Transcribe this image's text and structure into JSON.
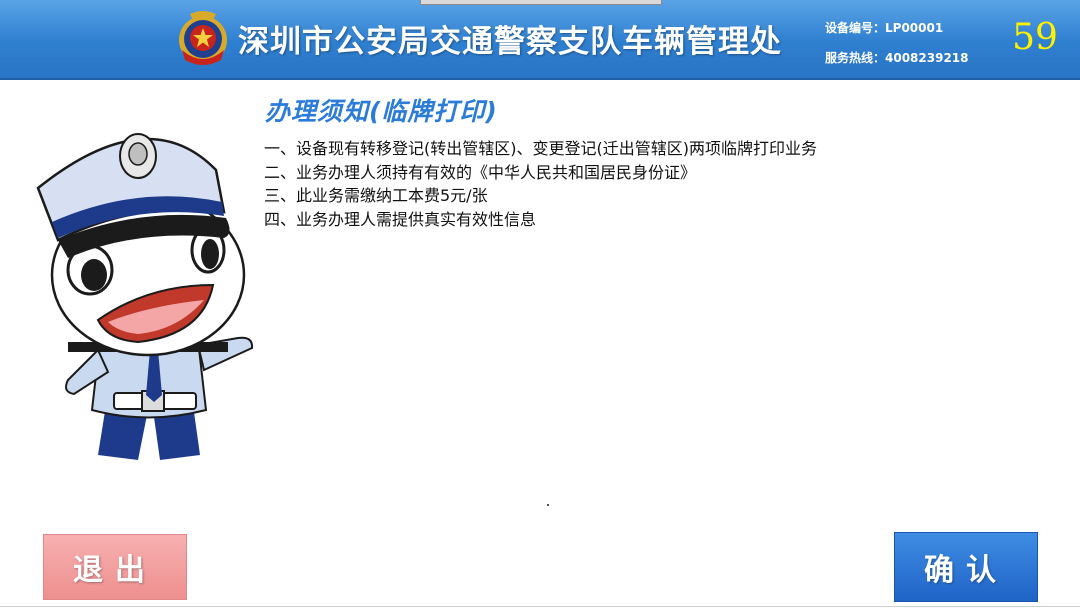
{
  "header": {
    "org_title": "深圳市公安局交通警察支队车辆管理处",
    "device_no": "设备编号：LP00001",
    "hotline": "服务热线：4008239218",
    "countdown": "59"
  },
  "notice": {
    "title": "办理须知(临牌打印)",
    "items": [
      "一、设备现有转移登记(转出管辖区)、变更登记(迁出管辖区)两项临牌打印业务",
      "二、业务办理人须持有有效的《中华人民共和国居民身份证》",
      "三、此业务需缴纳工本费5元/张",
      "四、业务办理人需提供真实有效性信息"
    ]
  },
  "buttons": {
    "exit": "退出",
    "confirm": "确认"
  },
  "colors": {
    "header_blue": "#2f7fd0",
    "countdown_yellow": "#fff200",
    "title_blue": "#2b7bd8",
    "exit_pink": "#ee8f8f",
    "confirm_blue": "#1f63c7"
  }
}
